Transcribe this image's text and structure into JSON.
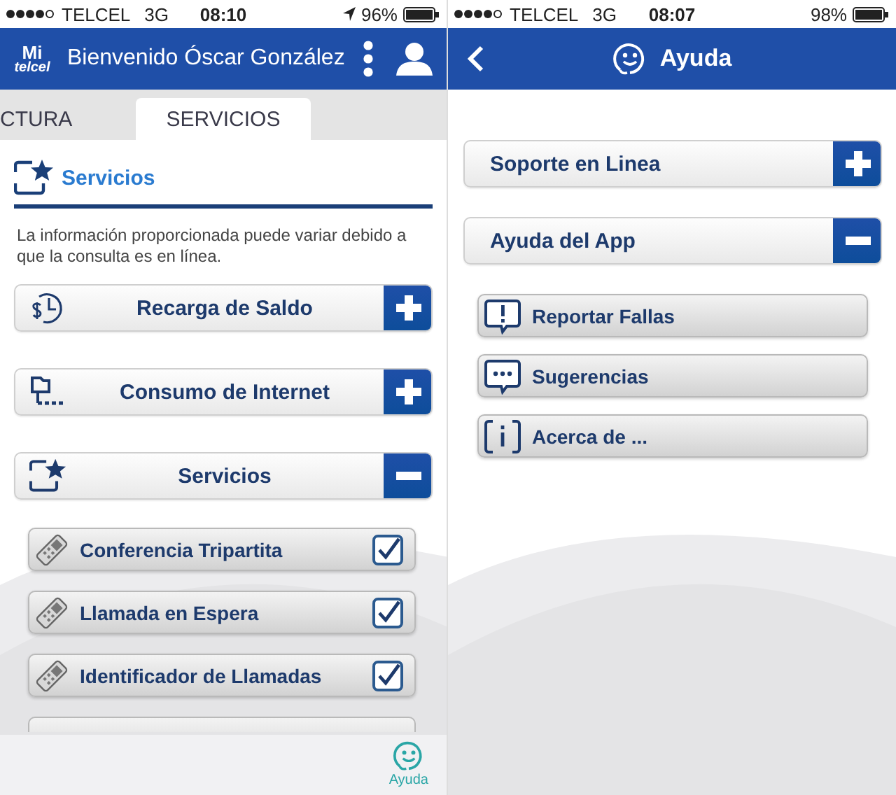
{
  "servicios_screen": {
    "status_bar": {
      "carrier": "TELCEL",
      "network": "3G",
      "time": "08:10",
      "location_on": true,
      "battery": "96%"
    },
    "header": {
      "logo_top": "Mi",
      "logo_bottom": "telcel",
      "title": "Bienvenido Óscar González"
    },
    "tabs": [
      {
        "label": "CTURA",
        "selected": false
      },
      {
        "label": "SERVICIOS",
        "selected": true
      }
    ],
    "section_title": "Servicios",
    "notice": "La información proporcionada puede variar debido a que la consulta es en línea.",
    "accordions": [
      {
        "kind": "recharge",
        "label": "Recarga de Saldo",
        "expanded": false
      },
      {
        "kind": "internet",
        "label": "Consumo de Internet",
        "expanded": false
      },
      {
        "kind": "services",
        "label": "Servicios",
        "expanded": true
      }
    ],
    "services": [
      {
        "label": "Conferencia Tripartita",
        "checked": true
      },
      {
        "label": "Llamada en Espera",
        "checked": true
      },
      {
        "label": "Identificador de Llamadas",
        "checked": true
      }
    ],
    "tab_bar": {
      "label": "Ayuda"
    }
  },
  "ayuda_screen": {
    "status_bar": {
      "carrier": "TELCEL",
      "network": "3G",
      "time": "08:07",
      "location_on": false,
      "battery": "98%"
    },
    "header": {
      "title": "Ayuda"
    },
    "accordions": [
      {
        "label": "Soporte en Linea",
        "expanded": false
      },
      {
        "label": "Ayuda del App",
        "expanded": true
      }
    ],
    "items": [
      {
        "kind": "alert",
        "label": "Reportar Fallas"
      },
      {
        "kind": "chat",
        "label": "Sugerencias"
      },
      {
        "kind": "info",
        "label": "Acerca de ..."
      }
    ]
  }
}
